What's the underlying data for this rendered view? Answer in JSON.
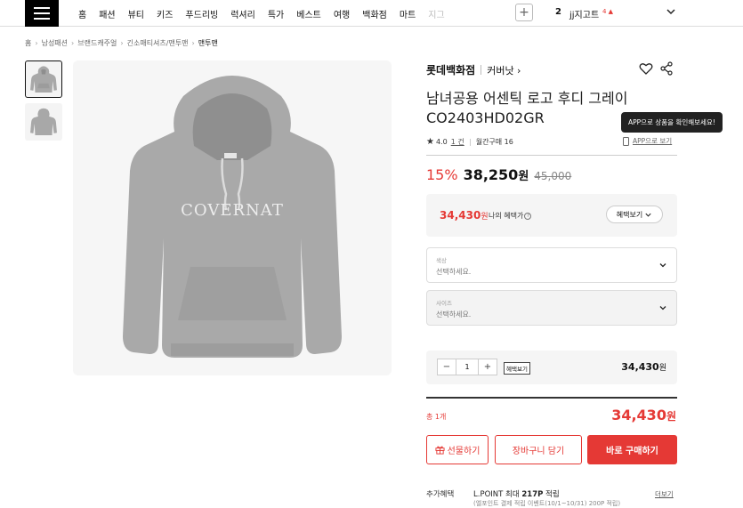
{
  "nav": {
    "items": [
      "홈",
      "패션",
      "뷰티",
      "키즈",
      "푸드리빙",
      "럭셔리",
      "특가",
      "베스트",
      "여행",
      "백화점",
      "마트",
      "지그"
    ],
    "plus": "+",
    "rank_number": "2",
    "rank_keyword": "jj지고트",
    "rank_change": "4 ▲"
  },
  "breadcrumb": [
    "홈",
    "남성패션",
    "브랜드캐주얼",
    "긴소매티셔츠/맨투맨",
    "맨투맨"
  ],
  "product": {
    "brand": "롯데백화점",
    "sub_brand": "커버낫 ›",
    "title": "남녀공용 어센틱 로고 후디 그레이 CO2403HD02GR",
    "image_logo": "COVERNAT",
    "rating": "4.0",
    "review_count": "1 건",
    "monthly_sales": "월간구매 16",
    "app_tooltip": "APP으로 상품을 확인해보세요!",
    "app_link": "APP으로 보기",
    "discount": "15%",
    "price": "38,250",
    "currency": "원",
    "original_price": "45,000"
  },
  "benefit": {
    "price": "34,430",
    "currency": "원",
    "label": "나의 혜택가",
    "button": "혜택보기"
  },
  "options": [
    {
      "label": "색상",
      "placeholder": "선택하세요."
    },
    {
      "label": "사이즈",
      "placeholder": "선택하세요."
    }
  ],
  "quantity": {
    "minus": "−",
    "value": "1",
    "plus": "+",
    "benefit_tag": "혜택보기",
    "price": "34,430",
    "currency": "원"
  },
  "total": {
    "label": "총 1개",
    "price": "34,430",
    "currency": "원"
  },
  "actions": {
    "gift": "선물하기",
    "cart": "장바구니 담기",
    "buy": "바로 구매하기"
  },
  "extra": {
    "label": "추가혜택",
    "lpoint_prefix": "L.POINT 최대 ",
    "lpoint_points": "217P",
    "lpoint_suffix": " 적립",
    "lpoint_sub": "(엘포인트 결제 적립 이벤트(10/1~10/31) 200P 적립)",
    "more": "더보기"
  },
  "colors": {
    "accent": "#e53935",
    "text": "#111111",
    "panel": "#f5f5f5"
  }
}
